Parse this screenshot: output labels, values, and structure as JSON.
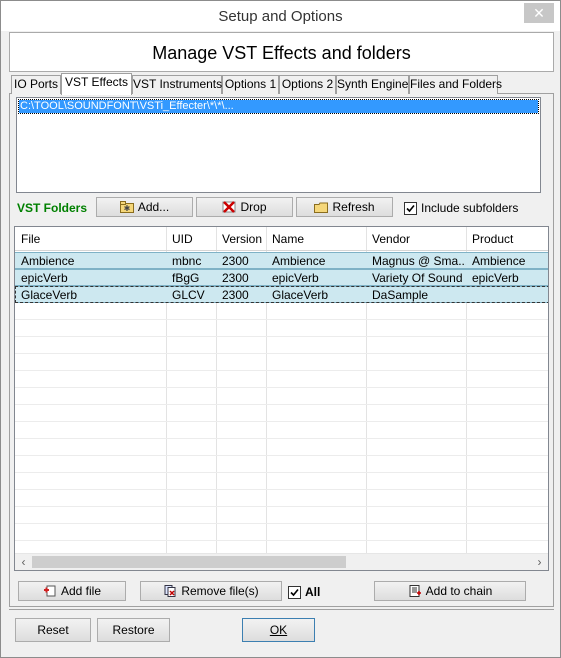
{
  "window": {
    "title": "Setup and Options",
    "close_glyph": "✕"
  },
  "header": {
    "title": "Manage VST Effects and folders"
  },
  "tabs": [
    {
      "label": "IO Ports"
    },
    {
      "label": "VST Effects"
    },
    {
      "label": "VST Instruments"
    },
    {
      "label": "Options 1"
    },
    {
      "label": "Options 2"
    },
    {
      "label": "Synth Engine"
    },
    {
      "label": "Files and Folders"
    }
  ],
  "active_tab": "VST Effects",
  "folders": {
    "items": [
      "C:\\TOOL\\SOUNDFONT\\VSTi_Effecter\\*\\*\\..."
    ],
    "label": "VST Folders",
    "add_label": "Add...",
    "drop_label": "Drop",
    "refresh_label": "Refresh",
    "include_subfolders_label": "Include subfolders",
    "include_subfolders_checked": true
  },
  "effects_table": {
    "columns": [
      "File",
      "UID",
      "Version",
      "Name",
      "Vendor",
      "Product"
    ],
    "rows": [
      [
        "Ambience",
        "mbnc",
        "2300",
        "Ambience",
        "Magnus @ Sma...",
        "Ambience"
      ],
      [
        "epicVerb",
        "fBgG",
        "2300",
        "epicVerb",
        "Variety Of Sound",
        "epicVerb"
      ],
      [
        "GlaceVerb",
        "GLCV",
        "2300",
        "GlaceVerb",
        "DaSample",
        ""
      ]
    ],
    "selected_rows": [
      0,
      1,
      2
    ],
    "focused_row": 2
  },
  "table_actions": {
    "add_file_label": "Add file",
    "remove_files_label": "Remove file(s)",
    "all_label": "All",
    "all_checked": true,
    "add_to_chain_label": "Add to chain"
  },
  "footer": {
    "reset_label": "Reset",
    "restore_label": "Restore",
    "ok_label": "OK"
  },
  "colors": {
    "accent_green": "#008000",
    "selection_blue": "#3399ff",
    "row_highlight": "#cde8f0",
    "drop_icon_red": "#cc0000",
    "add_file_red": "#d02020",
    "remove_files_red": "#c00000"
  },
  "icons": {
    "add": "folder-add-icon",
    "drop": "drop-x-icon",
    "refresh": "folder-refresh-icon",
    "add_file": "file-add-icon",
    "remove_files": "files-remove-icon",
    "add_to_chain": "chain-add-icon"
  }
}
